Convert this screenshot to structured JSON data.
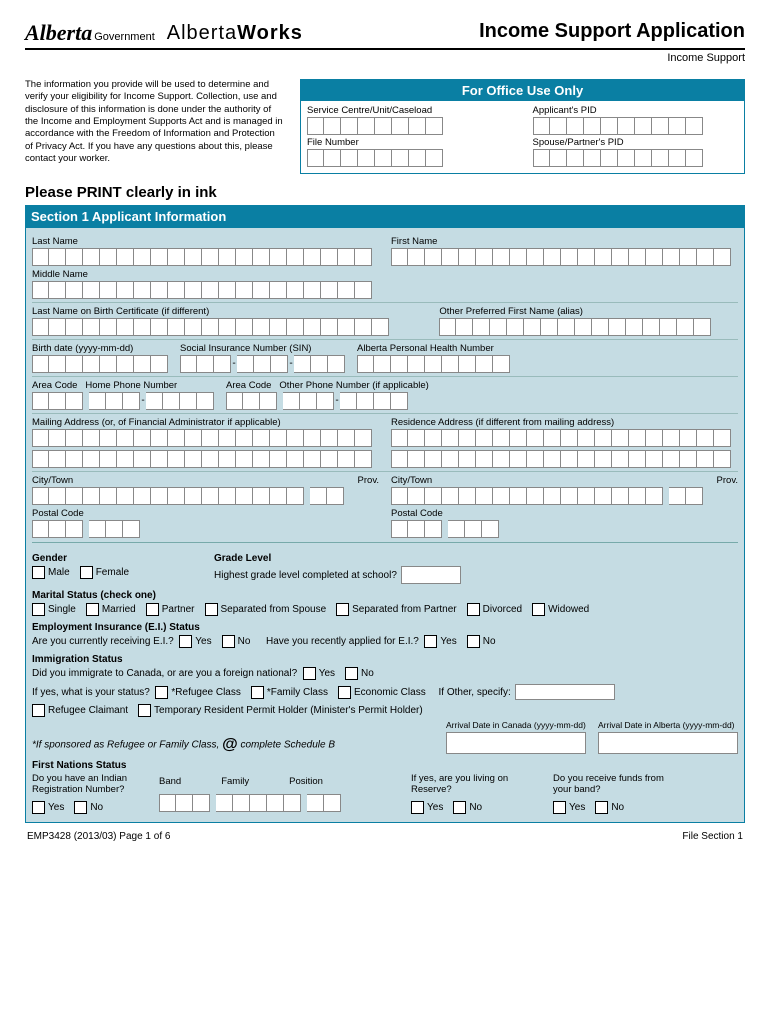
{
  "header": {
    "logo1_script": "Alberta",
    "logo1_suffix": "Government",
    "logo2_prefix": "Alberta",
    "logo2_bold": "Works",
    "title": "Income Support Application",
    "subtitle": "Income Support"
  },
  "intro": "The information you provide will be used to determine and verify your eligibility for Income Support. Collection, use and disclosure of this information is done under the authority of the Income and Employment Supports Act and is managed in accordance with the Freedom of Information and Protection of Privacy Act. If you have any questions about this, please contact your worker.",
  "office": {
    "header": "For Office Use Only",
    "service_centre": "Service Centre/Unit/Caseload",
    "applicant_pid": "Applicant's PID",
    "file_number": "File Number",
    "spouse_pid": "Spouse/Partner's PID"
  },
  "print_instruction": "Please PRINT clearly in ink",
  "section1": {
    "header": "Section 1  Applicant Information",
    "last_name": "Last Name",
    "first_name": "First Name",
    "middle_name": "Middle Name",
    "birth_cert": "Last Name on Birth Certificate (if different)",
    "alias": "Other Preferred First Name (alias)",
    "birth_date": "Birth date (yyyy-mm-dd)",
    "sin": "Social Insurance Number (SIN)",
    "health": "Alberta Personal Health Number",
    "area_code1": "Area Code",
    "home_phone": "Home Phone Number",
    "area_code2": "Area Code",
    "other_phone": "Other Phone Number (if applicable)",
    "mailing": "Mailing Address (or, of Financial Administrator if applicable)",
    "residence": "Residence Address (if different from mailing address)",
    "city": "City/Town",
    "prov": "Prov.",
    "postal": "Postal Code",
    "gender": "Gender",
    "male": "Male",
    "female": "Female",
    "grade_level": "Grade Level",
    "grade_q": "Highest grade level completed at school?",
    "marital_header": "Marital Status (check one)",
    "marital": [
      "Single",
      "Married",
      "Partner",
      "Separated from Spouse",
      "Separated from Partner",
      "Divorced",
      "Widowed"
    ],
    "ei_header": "Employment Insurance (E.I.) Status",
    "ei_q1": "Are you currently receiving E.I.?",
    "ei_q2": "Have you recently applied for E.I.?",
    "yes": "Yes",
    "no": "No",
    "imm_header": "Immigration Status",
    "imm_q1": "Did you immigrate to Canada, or are you a foreign national?",
    "imm_q2": "If yes, what is your status?",
    "ref_class": "*Refugee Class",
    "fam_class": "*Family Class",
    "eco_class": "Economic Class",
    "other_specify": "If Other, specify:",
    "ref_claimant": "Refugee Claimant",
    "temp_permit": "Temporary Resident Permit Holder (Minister's Permit Holder)",
    "sponsor_note_pre": "*If sponsored as Refugee or Family Class, ",
    "sponsor_note_post": " complete Schedule B",
    "arrival_canada": "Arrival Date in Canada (yyyy-mm-dd)",
    "arrival_alberta": "Arrival Date in Alberta (yyyy-mm-dd)",
    "fn_header": "First Nations Status",
    "fn_q1": "Do you have an Indian Registration Number?",
    "band": "Band",
    "family": "Family",
    "position": "Position",
    "fn_q2": "If yes, are you living on Reserve?",
    "fn_q3": "Do you receive funds from your band?"
  },
  "footer": {
    "left": "EMP3428 (2013/03)  Page 1 of 6",
    "right": "File Section 1"
  }
}
